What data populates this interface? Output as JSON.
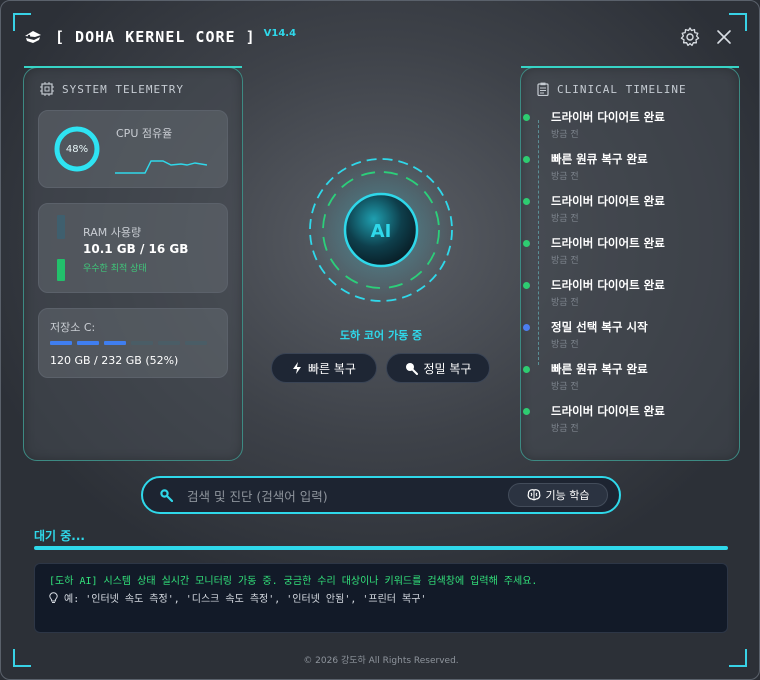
{
  "window": {
    "title": "[ DOHA KERNEL CORE ]",
    "version": "V14.4",
    "accent": "#2fd8ea"
  },
  "telemetry": {
    "title": "SYSTEM TELEMETRY",
    "cpu": {
      "label": "CPU 점유율",
      "percent": 48,
      "percent_text": "48%"
    },
    "ram": {
      "label": "RAM 사용량",
      "value": "10.1 GB / 16 GB",
      "status": "우수한 최적 상태"
    },
    "disk": {
      "label": "저장소 C:",
      "value": "120 GB / 232 GB (52%)",
      "percent": 52
    }
  },
  "core": {
    "label": "AI",
    "status": "도하 코어 가동 중",
    "buttons": {
      "quick": "빠른 복구",
      "precise": "정밀 복구"
    }
  },
  "timeline": {
    "title": "CLINICAL TIMELINE",
    "items": [
      {
        "title": "드라이버 다이어트 완료",
        "time": "방금 전",
        "color": "#2ecc71"
      },
      {
        "title": "빠른 원큐 복구 완료",
        "time": "방금 전",
        "color": "#2ecc71"
      },
      {
        "title": "드라이버 다이어트 완료",
        "time": "방금 전",
        "color": "#2ecc71"
      },
      {
        "title": "드라이버 다이어트 완료",
        "time": "방금 전",
        "color": "#2ecc71"
      },
      {
        "title": "드라이버 다이어트 완료",
        "time": "방금 전",
        "color": "#2ecc71"
      },
      {
        "title": "정밀 선택 복구 시작",
        "time": "방금 전",
        "color": "#4c7ef0"
      },
      {
        "title": "빠른 원큐 복구 완료",
        "time": "방금 전",
        "color": "#2ecc71"
      },
      {
        "title": "드라이버 다이어트 완료",
        "time": "방금 전",
        "color": "#2ecc71"
      }
    ]
  },
  "search": {
    "placeholder": "검색 및 진단 (검색어 입력)",
    "learn_label": "기능 학습"
  },
  "status": {
    "text": "대기 중...",
    "progress": 1.0
  },
  "console": {
    "line1": "[도하 AI] 시스템 상태 실시간 모니터링 가동 중. 궁금한 수리 대상이나 키워드를 검색창에 입력해 주세요.",
    "line2": "예: '인터넷 속도 측정', '디스크 속도 측정', '인터넷 안됨', '프린터 복구'"
  },
  "footer": "© 2026 강도하 All Rights Reserved."
}
